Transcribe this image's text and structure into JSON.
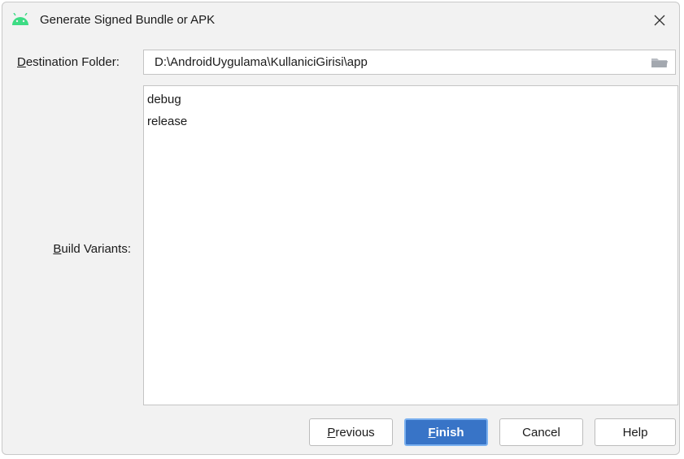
{
  "window": {
    "title": "Generate Signed Bundle or APK",
    "icon": "android-icon",
    "accent_color": "#3ddc84"
  },
  "form": {
    "destination": {
      "label_mnemonic": "D",
      "label_rest": "estination Folder:",
      "value": "D:\\AndroidUygulama\\KullaniciGirisi\\app",
      "icon": "folder-icon"
    },
    "build_variants": {
      "label_mnemonic": "B",
      "label_rest": "uild Variants:",
      "items": [
        "debug",
        "release"
      ]
    }
  },
  "buttons": {
    "previous": {
      "mnemonic": "P",
      "rest": "revious"
    },
    "finish": {
      "mnemonic": "F",
      "rest": "inish",
      "color": "#3874c7"
    },
    "cancel": {
      "label": "Cancel"
    },
    "help": {
      "label": "Help"
    }
  }
}
